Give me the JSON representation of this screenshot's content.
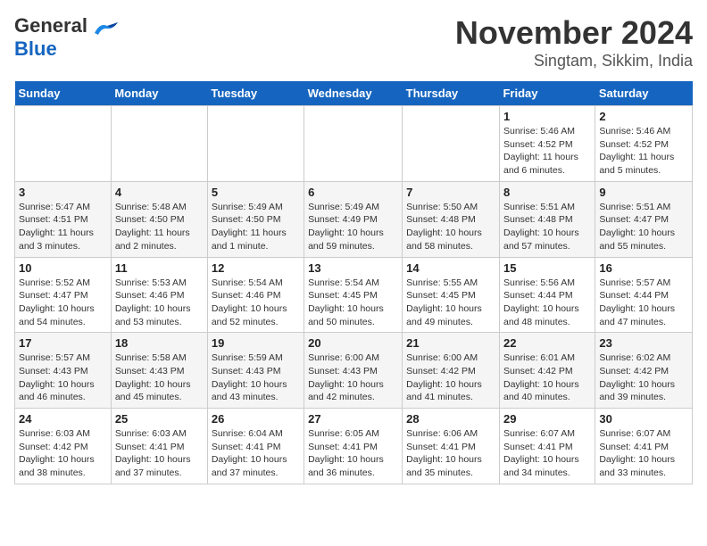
{
  "header": {
    "logo_line1": "General",
    "logo_line2": "Blue",
    "title": "November 2024",
    "subtitle": "Singtam, Sikkim, India"
  },
  "days_of_week": [
    "Sunday",
    "Monday",
    "Tuesday",
    "Wednesday",
    "Thursday",
    "Friday",
    "Saturday"
  ],
  "weeks": [
    [
      {
        "day": "",
        "info": ""
      },
      {
        "day": "",
        "info": ""
      },
      {
        "day": "",
        "info": ""
      },
      {
        "day": "",
        "info": ""
      },
      {
        "day": "",
        "info": ""
      },
      {
        "day": "1",
        "info": "Sunrise: 5:46 AM\nSunset: 4:52 PM\nDaylight: 11 hours\nand 6 minutes."
      },
      {
        "day": "2",
        "info": "Sunrise: 5:46 AM\nSunset: 4:52 PM\nDaylight: 11 hours\nand 5 minutes."
      }
    ],
    [
      {
        "day": "3",
        "info": "Sunrise: 5:47 AM\nSunset: 4:51 PM\nDaylight: 11 hours\nand 3 minutes."
      },
      {
        "day": "4",
        "info": "Sunrise: 5:48 AM\nSunset: 4:50 PM\nDaylight: 11 hours\nand 2 minutes."
      },
      {
        "day": "5",
        "info": "Sunrise: 5:49 AM\nSunset: 4:50 PM\nDaylight: 11 hours\nand 1 minute."
      },
      {
        "day": "6",
        "info": "Sunrise: 5:49 AM\nSunset: 4:49 PM\nDaylight: 10 hours\nand 59 minutes."
      },
      {
        "day": "7",
        "info": "Sunrise: 5:50 AM\nSunset: 4:48 PM\nDaylight: 10 hours\nand 58 minutes."
      },
      {
        "day": "8",
        "info": "Sunrise: 5:51 AM\nSunset: 4:48 PM\nDaylight: 10 hours\nand 57 minutes."
      },
      {
        "day": "9",
        "info": "Sunrise: 5:51 AM\nSunset: 4:47 PM\nDaylight: 10 hours\nand 55 minutes."
      }
    ],
    [
      {
        "day": "10",
        "info": "Sunrise: 5:52 AM\nSunset: 4:47 PM\nDaylight: 10 hours\nand 54 minutes."
      },
      {
        "day": "11",
        "info": "Sunrise: 5:53 AM\nSunset: 4:46 PM\nDaylight: 10 hours\nand 53 minutes."
      },
      {
        "day": "12",
        "info": "Sunrise: 5:54 AM\nSunset: 4:46 PM\nDaylight: 10 hours\nand 52 minutes."
      },
      {
        "day": "13",
        "info": "Sunrise: 5:54 AM\nSunset: 4:45 PM\nDaylight: 10 hours\nand 50 minutes."
      },
      {
        "day": "14",
        "info": "Sunrise: 5:55 AM\nSunset: 4:45 PM\nDaylight: 10 hours\nand 49 minutes."
      },
      {
        "day": "15",
        "info": "Sunrise: 5:56 AM\nSunset: 4:44 PM\nDaylight: 10 hours\nand 48 minutes."
      },
      {
        "day": "16",
        "info": "Sunrise: 5:57 AM\nSunset: 4:44 PM\nDaylight: 10 hours\nand 47 minutes."
      }
    ],
    [
      {
        "day": "17",
        "info": "Sunrise: 5:57 AM\nSunset: 4:43 PM\nDaylight: 10 hours\nand 46 minutes."
      },
      {
        "day": "18",
        "info": "Sunrise: 5:58 AM\nSunset: 4:43 PM\nDaylight: 10 hours\nand 45 minutes."
      },
      {
        "day": "19",
        "info": "Sunrise: 5:59 AM\nSunset: 4:43 PM\nDaylight: 10 hours\nand 43 minutes."
      },
      {
        "day": "20",
        "info": "Sunrise: 6:00 AM\nSunset: 4:43 PM\nDaylight: 10 hours\nand 42 minutes."
      },
      {
        "day": "21",
        "info": "Sunrise: 6:00 AM\nSunset: 4:42 PM\nDaylight: 10 hours\nand 41 minutes."
      },
      {
        "day": "22",
        "info": "Sunrise: 6:01 AM\nSunset: 4:42 PM\nDaylight: 10 hours\nand 40 minutes."
      },
      {
        "day": "23",
        "info": "Sunrise: 6:02 AM\nSunset: 4:42 PM\nDaylight: 10 hours\nand 39 minutes."
      }
    ],
    [
      {
        "day": "24",
        "info": "Sunrise: 6:03 AM\nSunset: 4:42 PM\nDaylight: 10 hours\nand 38 minutes."
      },
      {
        "day": "25",
        "info": "Sunrise: 6:03 AM\nSunset: 4:41 PM\nDaylight: 10 hours\nand 37 minutes."
      },
      {
        "day": "26",
        "info": "Sunrise: 6:04 AM\nSunset: 4:41 PM\nDaylight: 10 hours\nand 37 minutes."
      },
      {
        "day": "27",
        "info": "Sunrise: 6:05 AM\nSunset: 4:41 PM\nDaylight: 10 hours\nand 36 minutes."
      },
      {
        "day": "28",
        "info": "Sunrise: 6:06 AM\nSunset: 4:41 PM\nDaylight: 10 hours\nand 35 minutes."
      },
      {
        "day": "29",
        "info": "Sunrise: 6:07 AM\nSunset: 4:41 PM\nDaylight: 10 hours\nand 34 minutes."
      },
      {
        "day": "30",
        "info": "Sunrise: 6:07 AM\nSunset: 4:41 PM\nDaylight: 10 hours\nand 33 minutes."
      }
    ]
  ]
}
